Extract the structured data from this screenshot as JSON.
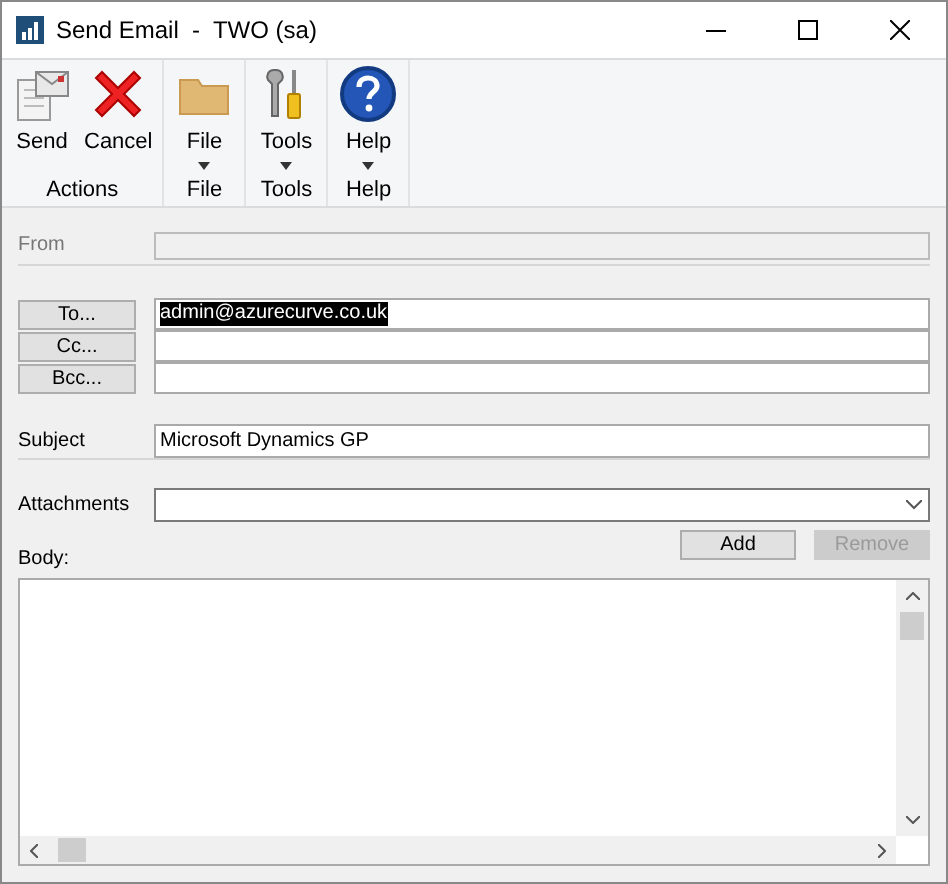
{
  "window": {
    "title": "Send Email  -  TWO (sa)"
  },
  "ribbon": {
    "groups": [
      {
        "label": "Actions",
        "buttons": [
          {
            "label": "Send",
            "kind": "send",
            "dropdown": false
          },
          {
            "label": "Cancel",
            "kind": "cancel",
            "dropdown": false
          }
        ]
      },
      {
        "label": "File",
        "buttons": [
          {
            "label": "File",
            "kind": "folder",
            "dropdown": true
          }
        ]
      },
      {
        "label": "Tools",
        "buttons": [
          {
            "label": "Tools",
            "kind": "tools",
            "dropdown": true
          }
        ]
      },
      {
        "label": "Help",
        "buttons": [
          {
            "label": "Help",
            "kind": "help",
            "dropdown": true
          }
        ]
      }
    ]
  },
  "from": {
    "label": "From",
    "disabled": true
  },
  "recipients": [
    {
      "button": "To...",
      "value": "admin@azurecurve.co.uk",
      "text_selected": true
    },
    {
      "button": "Cc..."
    },
    {
      "button": "Bcc..."
    }
  ],
  "subject": {
    "label": "Subject",
    "value": "Microsoft Dynamics GP"
  },
  "attachments": {
    "label": "Attachments"
  },
  "attachment_buttons": [
    {
      "label": "Add",
      "disabled": false
    },
    {
      "label": "Remove",
      "disabled": true
    }
  ],
  "body": {
    "label": "Body:"
  }
}
